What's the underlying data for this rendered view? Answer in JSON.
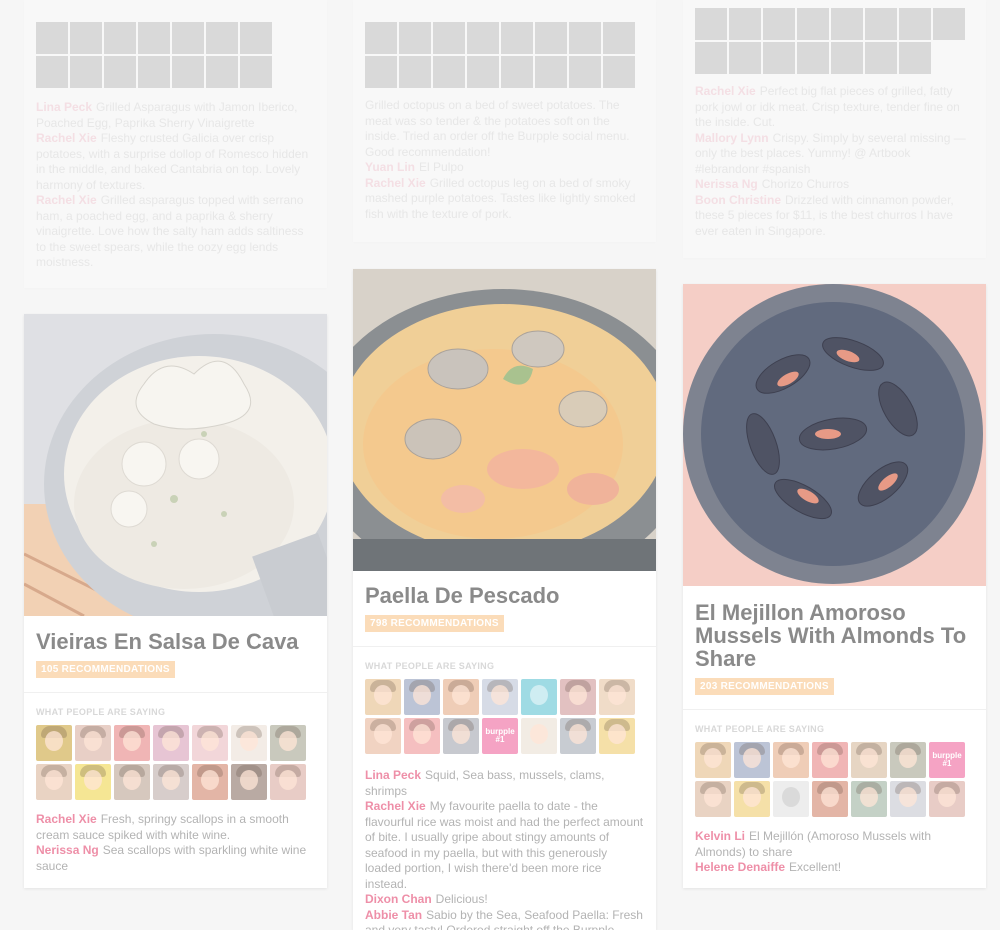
{
  "colors": {
    "accent_pink": "#ee8fa8",
    "badge_orange": "#fbdcb9",
    "title_gray": "#8a8a8a"
  },
  "ghost_cards": [
    {
      "reviews": [
        {
          "name": "Lina Peck",
          "text": "Grilled Asparagus with Jamon Iberico, Poached Egg, Paprika Sherry Vinaigrette"
        },
        {
          "name": "Rachel Xie",
          "text": "Fleshy crusted Galicia over crisp potatoes, with a surprise dollop of Romesco hidden in the middle, and baked Cantabria on top. Lovely harmony of textures."
        },
        {
          "name": "Rachel Xie",
          "text": "Grilled asparagus topped with serrano ham, a poached egg, and a paprika & sherry vinaigrette. Love how the salty ham adds saltiness to the sweet spears, while the oozy egg lends moistness."
        }
      ]
    },
    {
      "reviews": [
        {
          "name": "",
          "text": "Grilled octopus on a bed of sweet potatoes. The meat was so tender & the potatoes soft on the inside. Tried an order off the Burpple social menu. Good recommendation!"
        },
        {
          "name": "Yuan Lin",
          "text": "El Pulpo"
        },
        {
          "name": "Rachel Xie",
          "text": "Grilled octopus leg on a bed of smoky mashed purple potatoes. Tastes like lightly smoked fish with the texture of pork."
        }
      ]
    },
    {
      "reviews": [
        {
          "name": "Rachel Xie",
          "text": "Perfect big flat pieces of grilled, fatty pork jowl or idk meat. Crisp texture, tender fine on the inside. Cut."
        },
        {
          "name": "Mallory Lynn",
          "text": "Crispy. Simply by several missing — only the best places. Yummy! @ Artbook #lebrandonr #spanish"
        },
        {
          "name": "Nerissa Ng",
          "text": "Chorizo Churros"
        },
        {
          "name": "Boon Christine",
          "text": "Drizzled with cinnamon powder, these 5 pieces for $11, is the best churros I have ever eaten in Singapore."
        }
      ]
    }
  ],
  "cards": [
    {
      "title": "Vieiras En Salsa De Cava",
      "recommendations": "105 RECOMMENDATIONS",
      "saying": "WHAT PEOPLE ARE SAYING",
      "reviews": [
        {
          "name": "Rachel Xie",
          "text": "Fresh, springy scallops in a smooth cream sauce spiked with white wine."
        },
        {
          "name": "Nerissa Ng",
          "text": "Sea scallops with sparkling white wine sauce"
        }
      ]
    },
    {
      "title": "Paella De Pescado",
      "recommendations": "798 RECOMMENDATIONS",
      "saying": "WHAT PEOPLE ARE SAYING",
      "brand_avatar": "burpple #1",
      "reviews": [
        {
          "name": "Lina Peck",
          "text": "Squid, Sea bass, mussels, clams, shrimps"
        },
        {
          "name": "Rachel Xie",
          "text": "My favourite paella to date - the flavourful rice was moist and had the perfect amount of bite. I usually gripe about stingy amounts of seafood in my paella, but with this generously loaded portion, I wish there'd been more rice instead."
        },
        {
          "name": "Dixon Chan",
          "text": "Delicious!"
        },
        {
          "name": "Abbie Tan",
          "text": "Sabio by the Sea, Seafood Paella: Fresh and very tasty! Ordered straight off the Burpple social menu based on Burpplers good"
        }
      ]
    },
    {
      "title": "El Mejillon Amoroso Mussels With Almonds To Share",
      "recommendations": "203 RECOMMENDATIONS",
      "saying": "WHAT PEOPLE ARE SAYING",
      "brand_avatar": "burpple #1",
      "reviews": [
        {
          "name": "Kelvin Li",
          "text": "El Mejillón (Amoroso Mussels with Almonds) to share"
        },
        {
          "name": "Helene Denaiffe",
          "text": "Excellent!"
        }
      ]
    }
  ]
}
